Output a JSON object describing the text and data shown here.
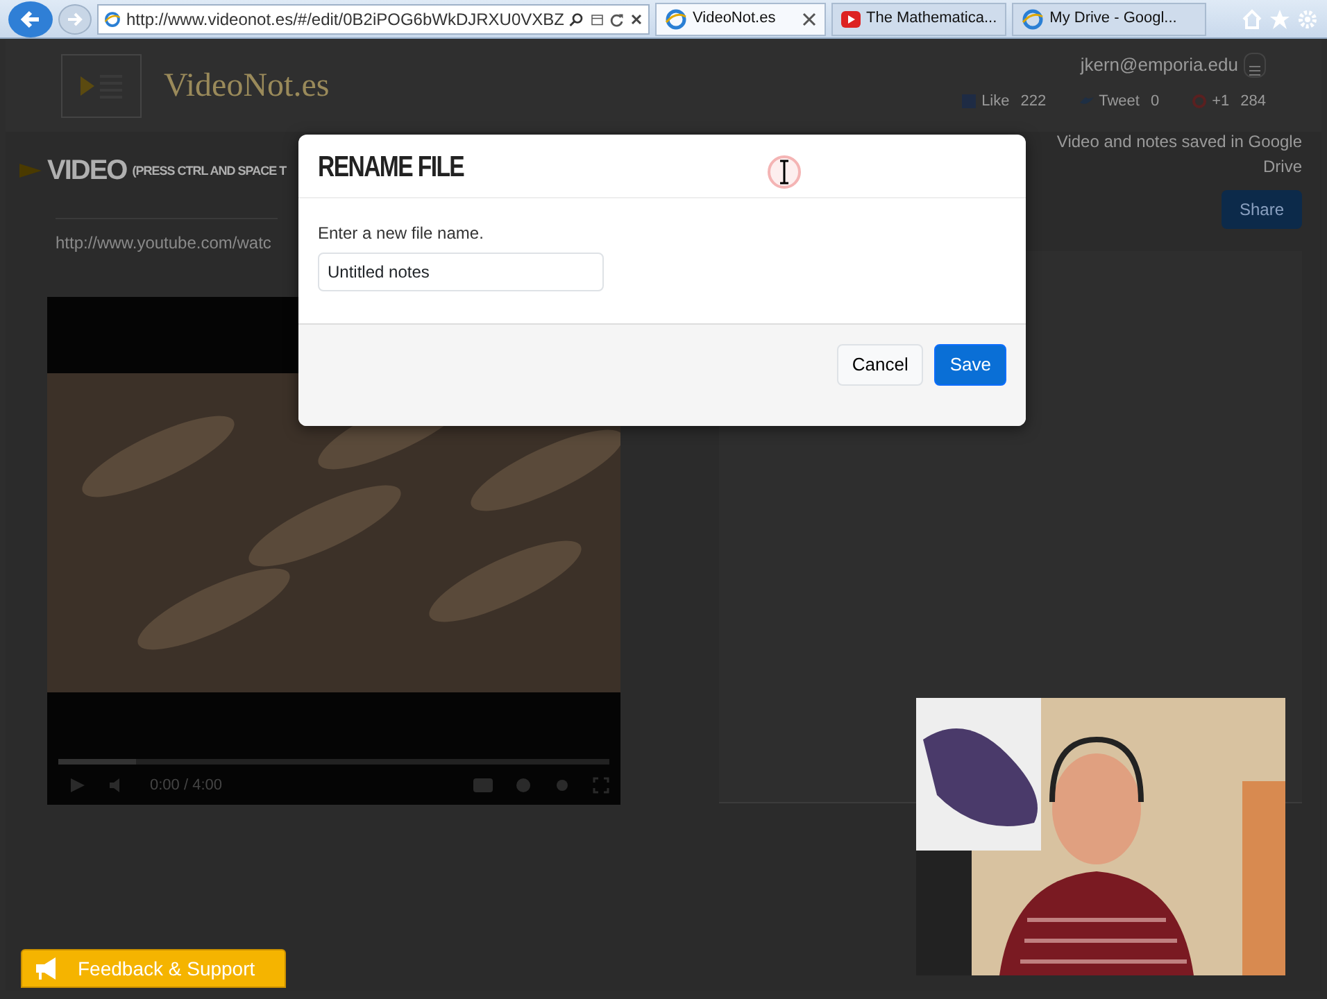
{
  "browser": {
    "url": "http://www.videonot.es/#/edit/0B2iPOG6bWkDJRXU0VXBZ",
    "tabs": [
      {
        "title": "VideoNot.es",
        "selected": true,
        "kind": "site"
      },
      {
        "title": "The Mathematica...",
        "selected": false,
        "kind": "video"
      },
      {
        "title": "My Drive - Googl...",
        "selected": false,
        "kind": "site"
      }
    ]
  },
  "page": {
    "logo": "VideoNot.es",
    "user": "jkern@emporia.edu",
    "social": [
      {
        "kind": "facebook",
        "label": "Like",
        "count": "222"
      },
      {
        "kind": "twitter",
        "label": "Tweet",
        "count": "0"
      },
      {
        "kind": "google",
        "label": "+1",
        "count": "284"
      }
    ],
    "section_title": "VIDEO",
    "section_hint": "(PRESS CTRL AND SPACE T",
    "video_url": "http://www.youtube.com/watc",
    "player": {
      "level": 0.14,
      "time": "0:00 / 4:00"
    },
    "status": "Video and notes saved in Google Drive",
    "share": "Share",
    "feedback": "Feedback & Support"
  },
  "modal": {
    "title": "RENAME FILE",
    "label": "Enter a new file name.",
    "value": "Untitled notes",
    "buttons": [
      {
        "label": "Cancel",
        "kind": "secondary"
      },
      {
        "label": "Save",
        "kind": "primary"
      }
    ]
  }
}
